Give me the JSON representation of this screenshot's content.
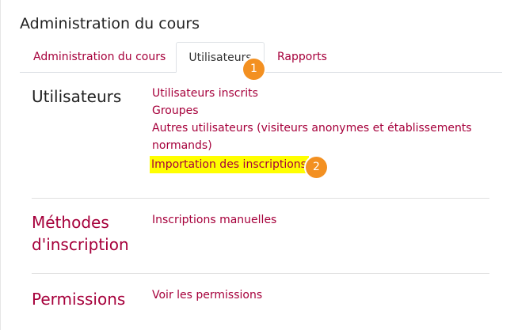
{
  "page": {
    "title": "Administration du cours"
  },
  "tabs": [
    {
      "label": "Administration du cours"
    },
    {
      "label": "Utilisateurs"
    },
    {
      "label": "Rapports"
    }
  ],
  "badges": [
    "1",
    "2"
  ],
  "sections": [
    {
      "title": "Utilisateurs",
      "links": [
        "Utilisateurs inscrits",
        "Groupes",
        "Autres utilisateurs (visiteurs anonymes et établissements",
        "normands)",
        "Importation des inscriptions"
      ]
    },
    {
      "title_line1": "Méthodes",
      "title_line2": "d'inscription",
      "links": [
        "Inscriptions manuelles"
      ]
    },
    {
      "title": "Permissions",
      "links": [
        "Voir les permissions"
      ]
    }
  ],
  "colors": {
    "link": "#a6003b",
    "badge": "#f39021",
    "highlight": "#ffff00"
  }
}
